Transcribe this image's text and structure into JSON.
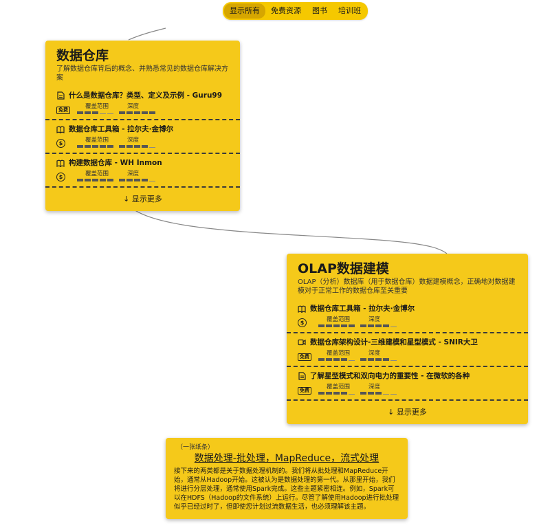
{
  "filters": [
    {
      "label": "显示所有",
      "active": true
    },
    {
      "label": "免费资源",
      "active": false
    },
    {
      "label": "图书",
      "active": false
    },
    {
      "label": "培训班",
      "active": false
    }
  ],
  "labels": {
    "coverage": "覆盖范围",
    "depth": "深度"
  },
  "card1": {
    "title": "数据仓库",
    "description": "了解数据仓库背后的概念、并熟悉常见的数据仓库解决方案",
    "show_more": "↓ 显示更多",
    "resources": [
      {
        "icon": "article-icon",
        "title": "什么是数据仓库？类型、定义及示例 - Guru99",
        "badge": "免费",
        "coverage": 3,
        "depth": 5
      },
      {
        "icon": "book-icon",
        "title": "数据仓库工具箱 - 拉尔夫·金博尔",
        "badge": "$",
        "coverage": 5,
        "depth": 4
      },
      {
        "icon": "book-icon",
        "title": "构建数据仓库 - WH Inmon",
        "badge": "$",
        "coverage": 5,
        "depth": 4
      }
    ]
  },
  "card2": {
    "title": "OLAP数据建模",
    "description": "OLAP（分析）数据库（用于数据仓库）数据建模概念，正确地对数据建模对于正常工作的数据仓库至关重要",
    "show_more": "↓ 显示更多",
    "resources": [
      {
        "icon": "book-icon",
        "title": "数据仓库工具箱 - 拉尔夫·金博尔",
        "badge": "$",
        "coverage": 5,
        "depth": 4
      },
      {
        "icon": "video-icon",
        "title": "数据仓库架构设计-三维建模和星型模式 - SNIR大卫",
        "badge": "免费",
        "coverage": 4,
        "depth": 4
      },
      {
        "icon": "article-icon",
        "title": "了解星型模式和双向电力的重要性 - 在微软的各种",
        "badge": "免费",
        "coverage": 4,
        "depth": 3
      }
    ]
  },
  "note": {
    "tag": "（一张纸条）",
    "title": "数据处理-批处理，MapReduce，流式处理",
    "body": "接下来的两类都是关于数据处理机制的。我们将从批处理和MapReduce开始，通常从Hadoop开始。这被认为是数据处理的第一代。从那里开始，我们将进行分层处理，通常使用Spark完成。这些主题紧密相连。例如，Spark可以在HDFS（Hadoop的文件系统）上运行。尽管了解使用Hadoop进行批处理似乎已经过时了，但即使您计划过流数据生活，也必须理解该主题。"
  }
}
